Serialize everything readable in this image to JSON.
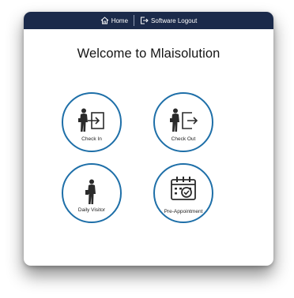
{
  "nav": {
    "home_label": "Home",
    "logout_label": "Software Logout"
  },
  "welcome": {
    "title": "Welcome to Mlaisolution"
  },
  "tiles": [
    {
      "label": "Check In",
      "icon": "person-check-in-icon"
    },
    {
      "label": "Check Out",
      "icon": "person-check-out-icon"
    },
    {
      "label": "Daily Visitor",
      "icon": "walking-person-icon"
    },
    {
      "label": "Pre-Appointment",
      "icon": "calendar-check-icon"
    }
  ],
  "colors": {
    "topbar": "#1b2a4a",
    "tile_border": "#1e6fa8"
  }
}
